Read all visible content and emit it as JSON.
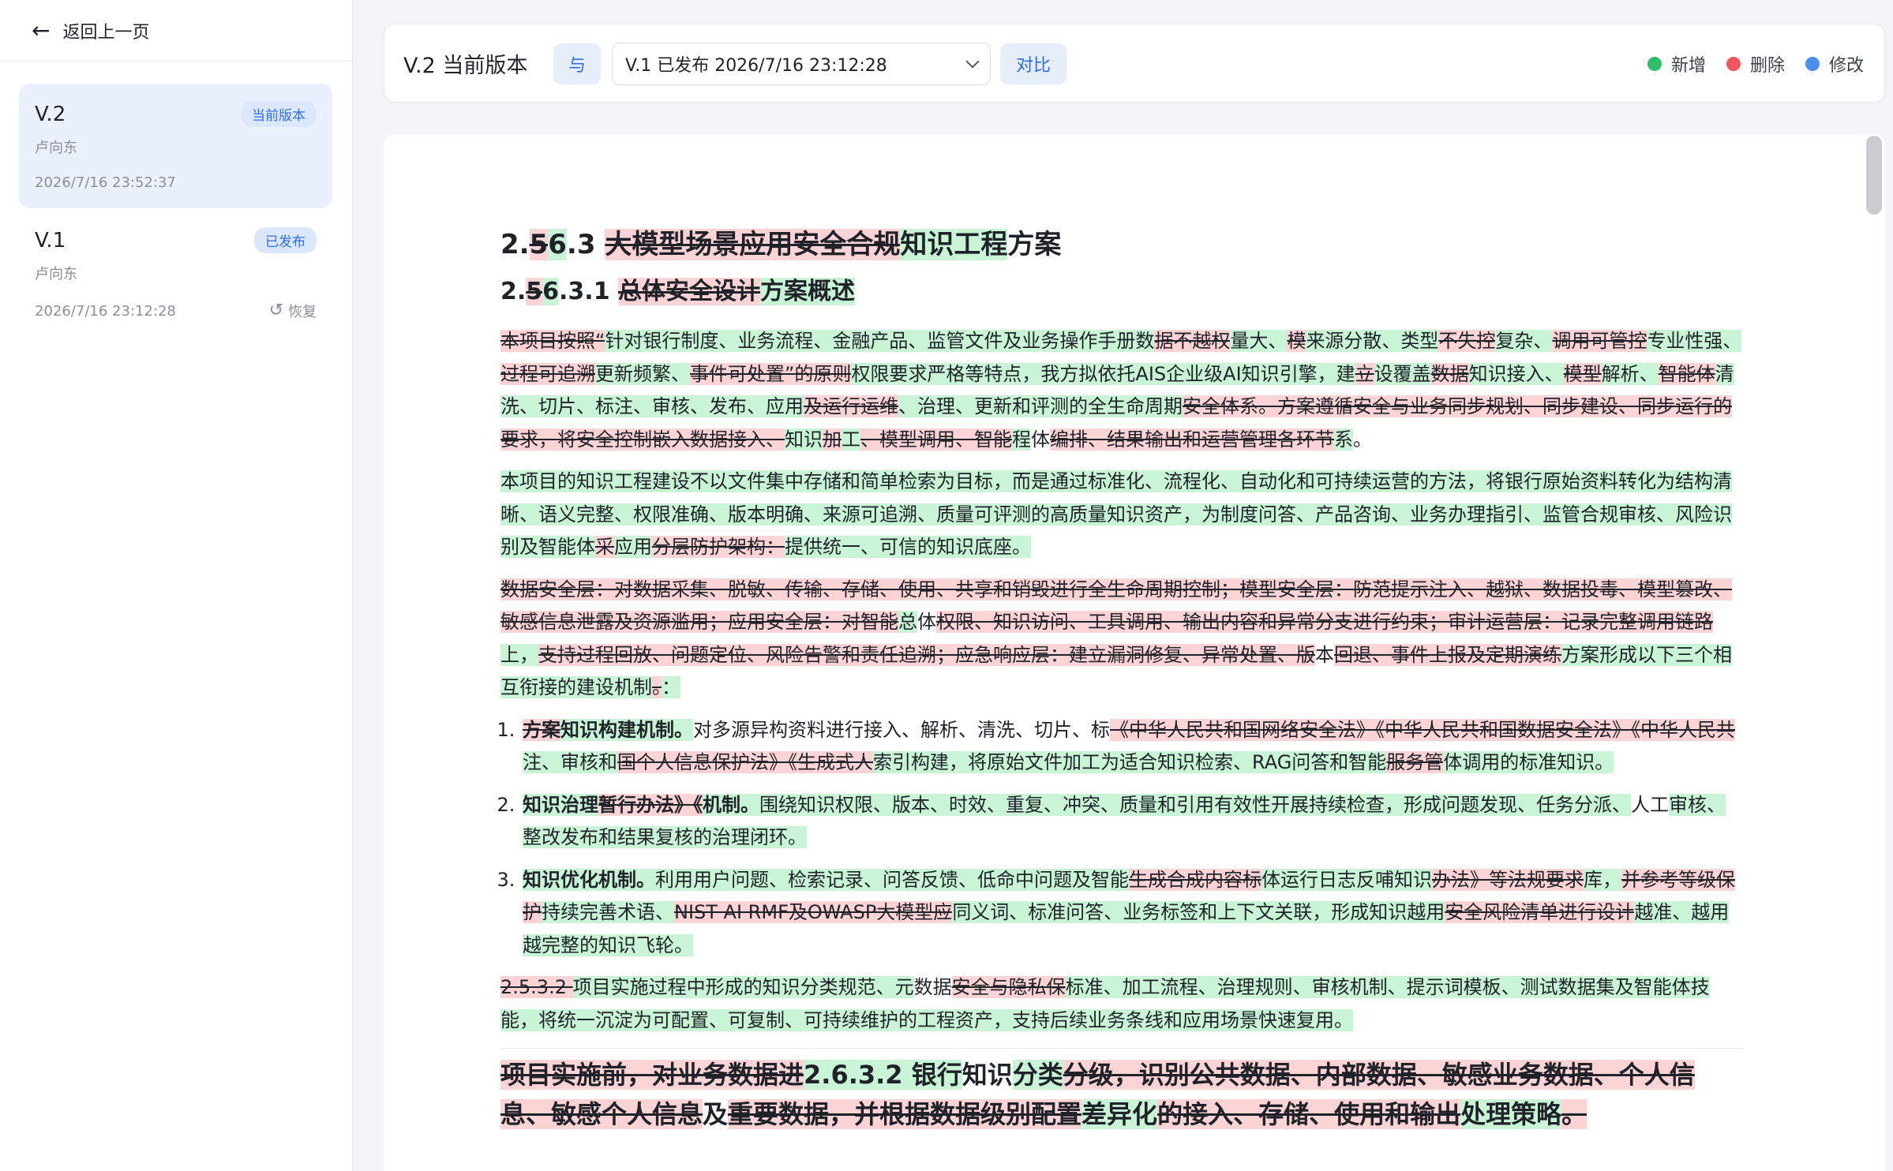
{
  "sidebar": {
    "back_label": "返回上一页",
    "versions": [
      {
        "title": "V.2",
        "badge": "当前版本",
        "author": "卢向东",
        "date": "2026/7/16 23:52:37"
      },
      {
        "title": "V.1",
        "badge": "已发布",
        "author": "卢向东",
        "date": "2026/7/16 23:12:28",
        "restore_label": "恢复"
      }
    ]
  },
  "topbar": {
    "title": "V.2 当前版本",
    "with_label": "与",
    "compare_select_value": "V.1 已发布 2026/7/16 23:12:28",
    "compare_button": "对比",
    "legend": [
      {
        "label": "新增",
        "color": "#2fbf6a"
      },
      {
        "label": "删除",
        "color": "#f0565b"
      },
      {
        "label": "修改",
        "color": "#4a90f2"
      }
    ]
  },
  "colors": {
    "added_bg": "#c9f5d6",
    "deleted_bg": "#fdd4d6",
    "accent": "#2e6de5"
  },
  "document": {
    "heading1": [
      {
        "t": "n",
        "s": "2."
      },
      {
        "t": "d",
        "s": "5"
      },
      {
        "t": "a",
        "s": "6"
      },
      {
        "t": "n",
        "s": ".3 "
      },
      {
        "t": "d",
        "s": "大模型场景应用安全合规"
      },
      {
        "t": "a",
        "s": "知识工程"
      },
      {
        "t": "n",
        "s": "方案"
      }
    ],
    "heading2": [
      {
        "t": "n",
        "s": "2."
      },
      {
        "t": "d",
        "s": "5"
      },
      {
        "t": "a",
        "s": "6"
      },
      {
        "t": "n",
        "s": ".3.1 "
      },
      {
        "t": "d",
        "s": "总体安全设计"
      },
      {
        "t": "a",
        "s": "方案概述"
      }
    ],
    "para1": [
      {
        "t": "d",
        "s": "本项目按照“"
      },
      {
        "t": "a",
        "s": "针对银行制度、业务流程、金融产品、监管文件及业务操作手册数"
      },
      {
        "t": "d",
        "s": "据不越权"
      },
      {
        "t": "a",
        "s": "量大、"
      },
      {
        "t": "d",
        "s": "模"
      },
      {
        "t": "a",
        "s": "来源分散、类型"
      },
      {
        "t": "d",
        "s": "不失控"
      },
      {
        "t": "a",
        "s": "复杂、"
      },
      {
        "t": "d",
        "s": "调用可管控"
      },
      {
        "t": "a",
        "s": "专业性强、"
      },
      {
        "t": "d",
        "s": "过程可追溯"
      },
      {
        "t": "a",
        "s": "更新频繁、"
      },
      {
        "t": "d",
        "s": "事件可处置”的原则"
      },
      {
        "t": "a",
        "s": "权限要求严格等特点，我方拟依托AIS企业级AI知识引擎，建"
      },
      {
        "t": "d",
        "s": "立"
      },
      {
        "t": "a",
        "s": "设覆盖"
      },
      {
        "t": "d",
        "s": "数据"
      },
      {
        "t": "a",
        "s": "知识接入、"
      },
      {
        "t": "d",
        "s": "模型"
      },
      {
        "t": "a",
        "s": "解析、"
      },
      {
        "t": "d",
        "s": "智能体"
      },
      {
        "t": "a",
        "s": "清洗、切片、标注、审核、发布、应用"
      },
      {
        "t": "d",
        "s": "及运行运维"
      },
      {
        "t": "a",
        "s": "、治理、更新和评测的全生命周期"
      },
      {
        "t": "d",
        "s": "安全体系。方案遵循安全与业务同步规划、同步建设、同步运行的要求，将安全控制嵌入数据接入、"
      },
      {
        "t": "a",
        "s": "知识"
      },
      {
        "t": "d",
        "s": "加"
      },
      {
        "t": "a",
        "s": "工"
      },
      {
        "t": "d",
        "s": "、模型调用、智能"
      },
      {
        "t": "a",
        "s": "程"
      },
      {
        "t": "n",
        "s": "体"
      },
      {
        "t": "d",
        "s": "编排、结果输出和运营管理各环节"
      },
      {
        "t": "a",
        "s": "系"
      },
      {
        "t": "n",
        "s": "。"
      }
    ],
    "para2": [
      {
        "t": "a",
        "s": "本项目的知识工程建设不以文件集中存储和简单检索为目标，而是通过标准化、流程化、自动化和可持续运营的方法，将银行原始资料转化为结构清晰、语义完整、权限准确、版本明确、来源可追溯、质量可评测的高质量知识资产，为制度问答、产品咨询、业务办理指引、监管合规审核、风险识别及智能体"
      },
      {
        "t": "d",
        "s": "采"
      },
      {
        "t": "a",
        "s": "应用"
      },
      {
        "t": "d",
        "s": "分层防护架构："
      },
      {
        "t": "a",
        "s": "提供统一、可信的知识底座。"
      }
    ],
    "para3": [
      {
        "t": "d",
        "s": "数据安全层：对数据采集、脱敏、传输、存储、使用、共享和销毁进行全生命周期控制；模型安全层：防范提示注入、越狱、数据投毒、模型篡改、敏感信息泄露及资源滥用；应用安全层：对智能"
      },
      {
        "t": "a",
        "s": "总"
      },
      {
        "t": "n",
        "s": "体"
      },
      {
        "t": "d",
        "s": "权限、知识访问、工具调用、输出内容和异常分支进行约束；审计运营层：记录完整调用链路"
      },
      {
        "t": "a",
        "s": "上，"
      },
      {
        "t": "d",
        "s": "支持过程回放、问题定位、风险告警和责任追溯；应急响应层：建立漏洞修复、异常处置、版"
      },
      {
        "t": "n",
        "s": "本"
      },
      {
        "t": "d",
        "s": "回退、事件上报及定期演练"
      },
      {
        "t": "a",
        "s": "方案形成以下三个相互衔接的建设机制"
      },
      {
        "t": "d",
        "s": "。"
      },
      {
        "t": "a",
        "s": "："
      }
    ],
    "list": [
      [
        {
          "t": "d",
          "s": "方案",
          "b": true
        },
        {
          "t": "a",
          "s": "知识构建机制。",
          "b": true
        },
        {
          "t": "n",
          "s": "对多源异构资料进行接入、解析、清洗、切片、标"
        },
        {
          "t": "d",
          "s": "《中华人民共和国网络安全法》《中华人民共和国数据安全法》《中华人民共"
        },
        {
          "t": "a",
          "s": "注、审核和"
        },
        {
          "t": "d",
          "s": "国个人信息保护法》《生成式人"
        },
        {
          "t": "a",
          "s": "索引构建，将原始文件加工为适合知识检索、RAG问答和智能"
        },
        {
          "t": "d",
          "s": "服务管"
        },
        {
          "t": "a",
          "s": "体调用的标准知识。"
        }
      ],
      [
        {
          "t": "a",
          "s": "知识治理",
          "b": true
        },
        {
          "t": "d",
          "s": "暂行办法》《",
          "b": true
        },
        {
          "t": "a",
          "s": "机制。",
          "b": true
        },
        {
          "t": "a",
          "s": "围绕知识权限、版本、时效、重复、冲突、质量和引用有效性开展持续检查，形成问题发现、任务分派、"
        },
        {
          "t": "n",
          "s": "人工"
        },
        {
          "t": "a",
          "s": "审核、整改发布和结果复核的治理闭环。"
        }
      ],
      [
        {
          "t": "a",
          "s": "知识优化机制。",
          "b": true
        },
        {
          "t": "a",
          "s": "利用用户问题、检索记录、问答反馈、低命中问题及智能"
        },
        {
          "t": "d",
          "s": "生成合成内容标"
        },
        {
          "t": "a",
          "s": "体运行日志反哺知识"
        },
        {
          "t": "d",
          "s": "办法》等法规要求"
        },
        {
          "t": "a",
          "s": "库，"
        },
        {
          "t": "d",
          "s": "并参考等级保护"
        },
        {
          "t": "a",
          "s": "持续完善术语、"
        },
        {
          "t": "d",
          "s": "NIST AI RMF及OWASP大模型应"
        },
        {
          "t": "a",
          "s": "同义词、标准问答、业务标签和上下文关联，形成知识越用"
        },
        {
          "t": "d",
          "s": "安全风险清单进行设计"
        },
        {
          "t": "a",
          "s": "越准、越用越完整的知识飞轮。"
        }
      ]
    ],
    "para4": [
      {
        "t": "d",
        "s": "2.5.3.2 "
      },
      {
        "t": "a",
        "s": "项目实施过程中形成的知识分类规范、元"
      },
      {
        "t": "n",
        "s": "数据"
      },
      {
        "t": "d",
        "s": "安全与隐私保"
      },
      {
        "t": "a",
        "s": "标准、加工流程、治理规则、审核机制、提示词模板、测试数据集及智能体技能，将统一沉淀为可配置、可复制、可持续维护的工程资产，支持后续业务条线和应用场景快速复用。"
      }
    ],
    "para5": [
      {
        "t": "d",
        "s": "项目实施前，对业务数据进"
      },
      {
        "t": "a",
        "s": "2.6.3.2 "
      },
      {
        "t": "a",
        "s": "银行"
      },
      {
        "t": "n",
        "s": "知识"
      },
      {
        "t": "a",
        "s": "分类"
      },
      {
        "t": "d",
        "s": "分级，识别公共数据、内部数据、敏感业务数据、个人信息、敏感个人信息"
      },
      {
        "t": "n",
        "s": "及"
      },
      {
        "t": "d",
        "s": "重要数据，并根据数据级别配置"
      },
      {
        "t": "a",
        "s": "差异化"
      },
      {
        "t": "d",
        "s": "的接入、存储、使用和输出"
      },
      {
        "t": "a",
        "s": "处理策略"
      },
      {
        "t": "d",
        "s": "。"
      }
    ]
  }
}
